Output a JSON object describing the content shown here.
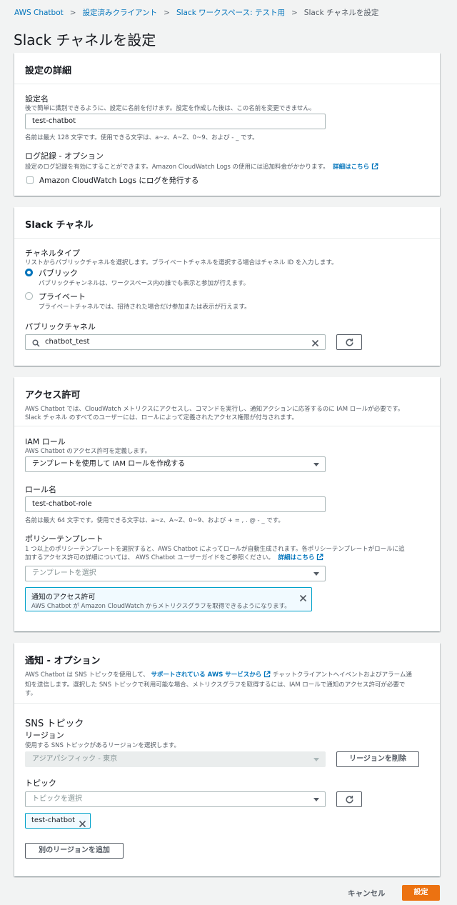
{
  "breadcrumb": {
    "items": [
      "AWS Chatbot",
      "設定済みクライアント",
      "Slack ワークスペース: テスト用",
      "Slack チャネルを設定"
    ],
    "separator": ">"
  },
  "page_title": "Slack チャネルを設定",
  "details": {
    "title": "設定の詳細",
    "name_label": "設定名",
    "name_desc": "後で簡単に識別できるように、設定に名前を付けます。設定を作成した後は、この名前を変更できません。",
    "name_value": "test-chatbot",
    "name_hint": "名前は最大 128 文字です。使用できる文字は、a~z、A~Z、0~9、および - _ です。",
    "logging_label": "ログ記録 - オプション",
    "logging_desc": "設定のログ記録を有効にすることができます。Amazon CloudWatch Logs の使用には追加料金がかかります。",
    "learn_more": "詳細はこちら",
    "logging_checkbox": "Amazon CloudWatch Logs にログを発行する"
  },
  "slack_channel": {
    "title": "Slack チャネル",
    "type_label": "チャネルタイプ",
    "type_desc": "リストからパブリックチャネルを選択します。プライベートチャネルを選択する場合はチャネル ID を入力します。",
    "public_label": "パブリック",
    "public_desc": "パブリックチャンネルは、ワークスペース内の誰でも表示と参加が行えます。",
    "private_label": "プライベート",
    "private_desc": "プライベートチャネルでは、招待された場合だけ参加または表示が行えます。",
    "public_channel_label": "パブリックチャネル",
    "public_channel_value": "chatbot_test"
  },
  "permissions": {
    "title": "アクセス許可",
    "desc_line1": "AWS Chatbot では、CloudWatch メトリクスにアクセスし、コマンドを実行し、通知アクションに応答するのに IAM ロールが必要です。",
    "desc_line2": "Slack チャネル のすべてのユーザーには、ロールによって定義されたアクセス権限が付与されます。",
    "iam_label": "IAM ロール",
    "iam_desc": "AWS Chatbot のアクセス許可を定義します。",
    "iam_value": "テンプレートを使用して IAM ロールを作成する",
    "role_name_label": "ロール名",
    "role_name_value": "test-chatbot-role",
    "role_name_hint": "名前は最大 64 文字です。使用できる文字は、a~z、A~Z、0~9、および + = , . @ - _ です。",
    "policy_label": "ポリシーテンプレート",
    "policy_desc1": "1 つ以上のポリシーテンプレートを選択すると、AWS Chatbot によってロールが自動生成されます。各ポリシーテンプレートがロールに追",
    "policy_desc2": "加するアクセス許可の詳細については、 AWS Chatbot ユーザーガイドをご参照ください。",
    "learn_more": "詳細はこちら",
    "policy_placeholder": "テンプレートを選択",
    "token_title": "通知のアクセス許可",
    "token_desc": "AWS Chatbot が Amazon CloudWatch からメトリクスグラフを取得できるようになります。"
  },
  "notifications": {
    "title": "通知 - オプション",
    "desc1_pre": "AWS Chatbot は SNS トピックを使用して、",
    "desc1_link": "サポートされている AWS サービスから",
    "desc1_post": "チャットクライアントへイベントおよびアラーム通",
    "desc2": "知を送信します。選択した SNS トピックで利用可能な場合、メトリクスグラフを取得するには、IAM ロールで通知のアクセス許可が必要で",
    "desc3": "す。",
    "sns_title": "SNS トピック",
    "region_label": "リージョン",
    "region_desc": "使用する SNS トピックがあるリージョンを選択します。",
    "region_value": "アジアパシフィック - 東京",
    "remove_region": "リージョンを削除",
    "topic_label": "トピック",
    "topic_placeholder": "トピックを選択",
    "topic_token": "test-chatbot",
    "add_region": "別のリージョンを追加"
  },
  "footer": {
    "cancel": "キャンセル",
    "submit": "設定"
  },
  "colors": {
    "link": "#0073bb",
    "primary": "#ec7211",
    "token_border": "#00a1c9"
  }
}
